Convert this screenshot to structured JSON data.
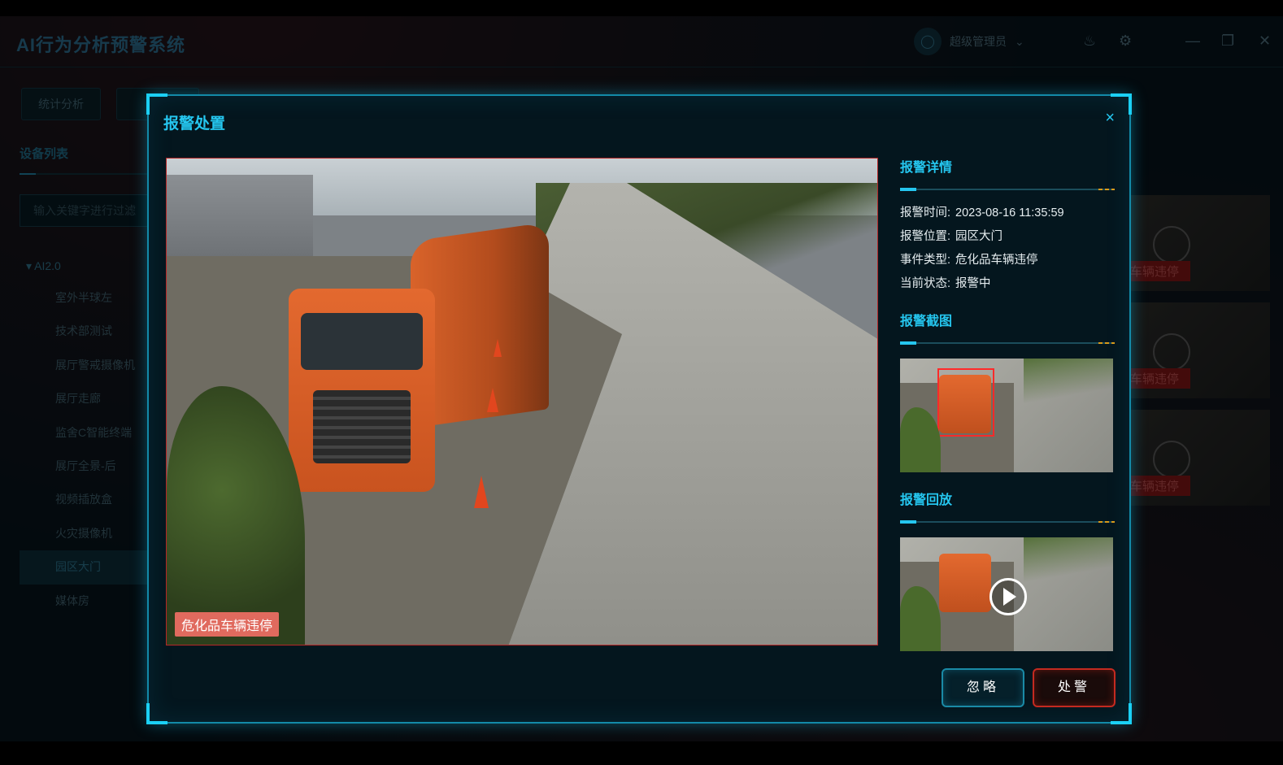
{
  "app": {
    "title": "AI行为分析预警系统",
    "user": "超级管理员"
  },
  "nav": {
    "tab1": "统计分析"
  },
  "sidebar": {
    "title": "设备列表",
    "search_placeholder": "输入关键字进行过滤",
    "group": "AI2.0",
    "items": [
      "室外半球左",
      "技术部测试",
      "展厅警戒摄像机",
      "展厅走廊",
      "监舍C智能终端",
      "展厅全景-后",
      "视频插放盒",
      "火灾摄像机",
      "园区大门",
      "媒体房"
    ]
  },
  "background_tags": [
    "车辆违停",
    "车辆违停",
    "车辆违停"
  ],
  "modal": {
    "title": "报警处置",
    "close_symbol": "×",
    "video_tag": "危化品车辆违停",
    "details": {
      "title": "报警详情",
      "time_label": "报警时间:",
      "time_value": "2023-08-16 11:35:59",
      "location_label": "报警位置:",
      "location_value": "园区大门",
      "type_label": "事件类型:",
      "type_value": "危化品车辆违停",
      "status_label": "当前状态:",
      "status_value": "报警中"
    },
    "screenshot_title": "报警截图",
    "playback_title": "报警回放",
    "buttons": {
      "ignore": "忽略",
      "handle": "处警"
    }
  },
  "colors": {
    "accent": "#25c6ef",
    "alert_red": "#c42a20",
    "tag_bg": "#e06a5e"
  }
}
